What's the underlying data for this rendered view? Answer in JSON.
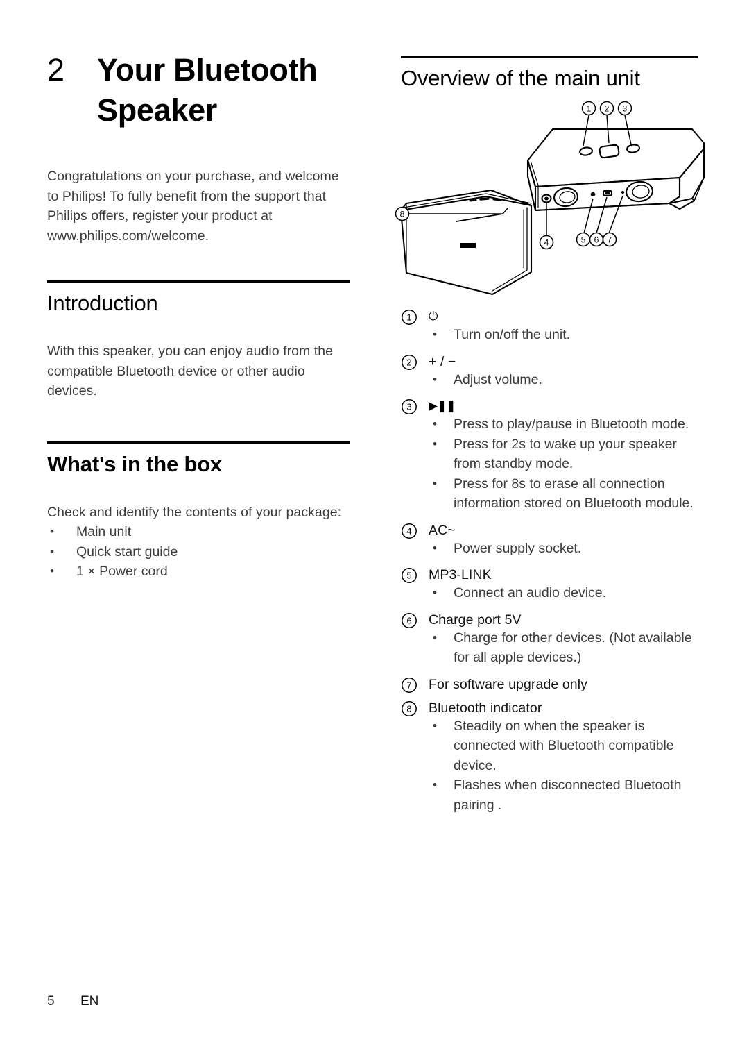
{
  "chapter": {
    "number": "2",
    "title_line1": "Your Bluetooth",
    "title_line2": "Speaker",
    "intro_paragraph": "Congratulations on your purchase, and welcome to Philips! To fully benefit from the support that Philips offers, register your product at www.philips.com/welcome."
  },
  "introduction": {
    "heading": "Introduction",
    "paragraph": "With this speaker, you can enjoy audio from the compatible Bluetooth device or other audio devices."
  },
  "whats_in_the_box": {
    "heading": "What's in the box",
    "paragraph": "Check and identify the contents of your package:",
    "items": [
      "Main unit",
      "Quick start guide",
      "1 × Power cord"
    ]
  },
  "overview": {
    "heading": "Overview of the main unit",
    "diagram": {
      "callouts": [
        "1",
        "2",
        "3",
        "4",
        "5",
        "6",
        "7",
        "8"
      ],
      "views": [
        "rear-top view",
        "front view"
      ]
    },
    "items": [
      {
        "number": "1",
        "label": "⏻",
        "label_kind": "power-icon",
        "bullets": [
          "Turn on/off the unit."
        ]
      },
      {
        "number": "2",
        "label": "+ / −",
        "label_kind": "text",
        "bullets": [
          "Adjust volume."
        ]
      },
      {
        "number": "3",
        "label": "▶❚❚",
        "label_kind": "play-pause-icon",
        "bullets": [
          "Press to play/pause in Bluetooth mode.",
          "Press for 2s to wake up your speaker from standby mode.",
          "Press for 8s to erase all connection information stored on Bluetooth module."
        ]
      },
      {
        "number": "4",
        "label": "AC~",
        "label_kind": "text",
        "bullets": [
          "Power supply socket."
        ]
      },
      {
        "number": "5",
        "label": "MP3-LINK",
        "label_kind": "text",
        "bullets": [
          "Connect an audio device."
        ]
      },
      {
        "number": "6",
        "label": "Charge port 5V",
        "label_kind": "text",
        "bullets": [
          "Charge for other devices. (Not available for all apple devices.)"
        ]
      },
      {
        "number": "7",
        "label": "For software upgrade only",
        "label_kind": "text",
        "bullets": []
      },
      {
        "number": "8",
        "label": "Bluetooth indicator",
        "label_kind": "text",
        "bullets": [
          "Steadily on when the speaker is connected with Bluetooth compatible device.",
          "Flashes when disconnected Bluetooth pairing ."
        ]
      }
    ]
  },
  "footer": {
    "page_number": "5",
    "language": "EN"
  },
  "colors": {
    "text_body": "#3c3c3c",
    "text_heading": "#000000",
    "rule": "#000000",
    "page_background": "#ffffff"
  }
}
